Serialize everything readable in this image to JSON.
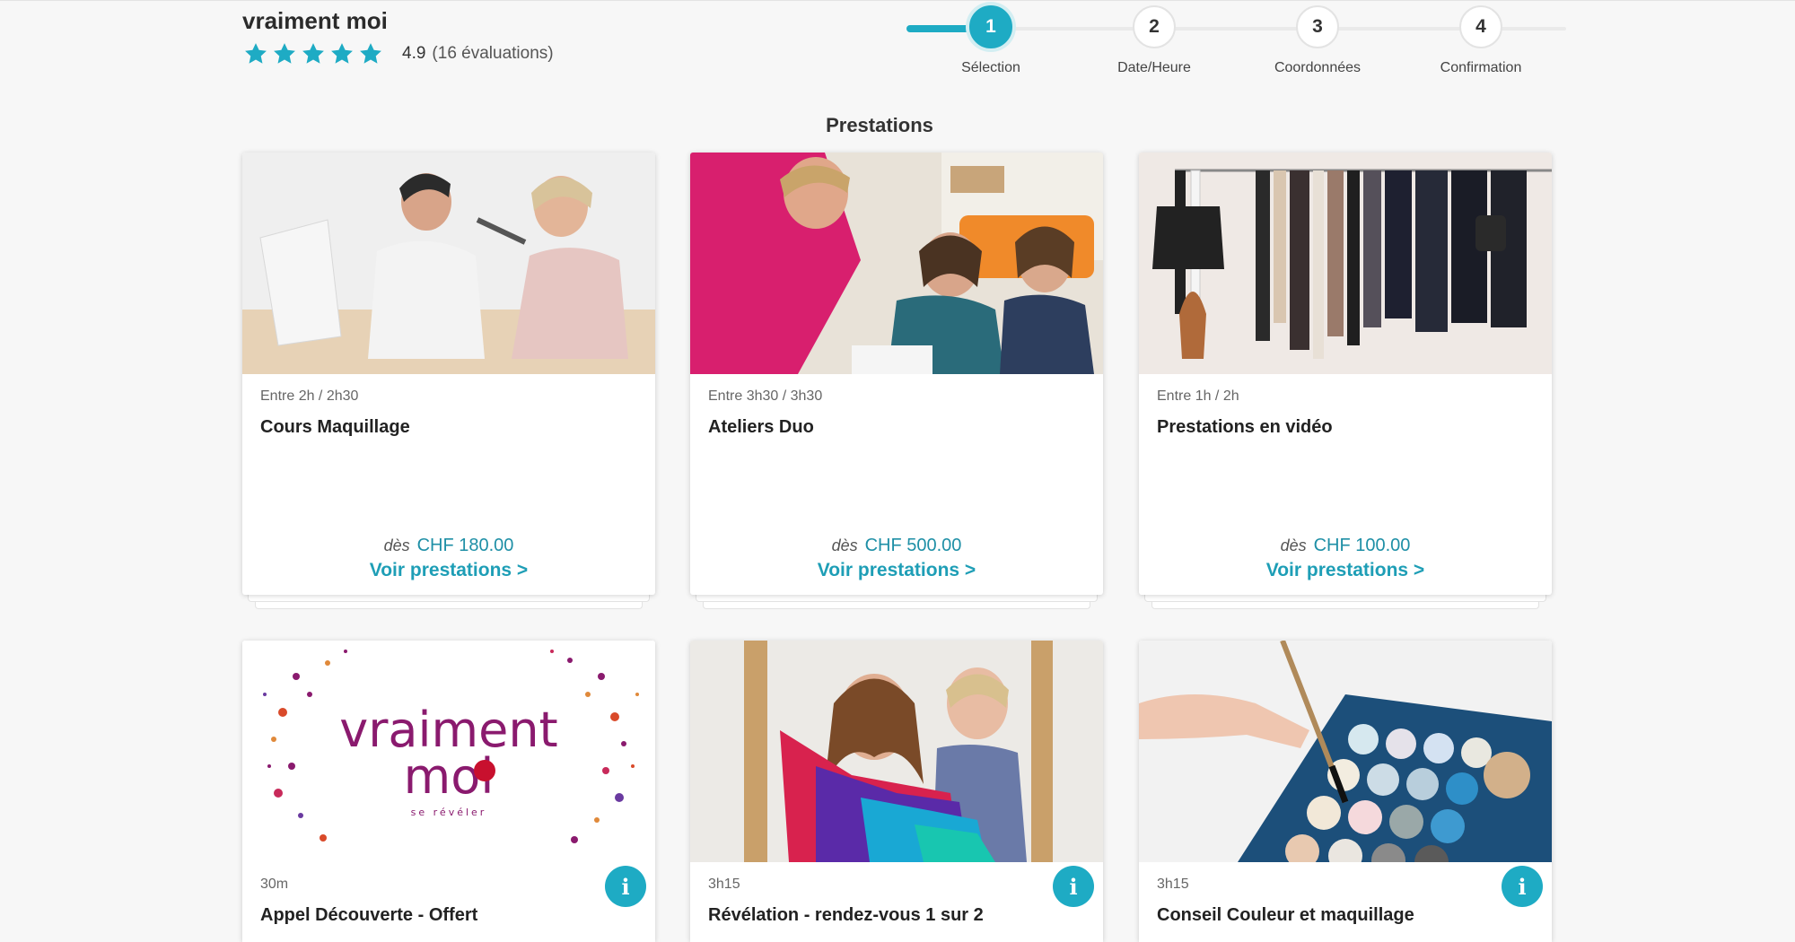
{
  "business": {
    "name": "vraiment moi",
    "rating_value": "4.9",
    "rating_count": "(16 évaluations)",
    "stars": 5
  },
  "stepper": {
    "current_step": 1,
    "steps": [
      {
        "number": "1",
        "label": "Sélection"
      },
      {
        "number": "2",
        "label": "Date/Heure"
      },
      {
        "number": "3",
        "label": "Coordonnées"
      },
      {
        "number": "4",
        "label": "Confirmation"
      }
    ]
  },
  "section_title": "Prestations",
  "cards": [
    {
      "duration": "Entre 2h / 2h30",
      "title": "Cours Maquillage",
      "price_prefix": "dès",
      "price": "CHF 180.00",
      "link": "Voir prestations  >"
    },
    {
      "duration": "Entre 3h30 / 3h30",
      "title": "Ateliers Duo",
      "price_prefix": "dès",
      "price": "CHF 500.00",
      "link": "Voir prestations  >"
    },
    {
      "duration": "Entre 1h / 2h",
      "title": "Prestations en vidéo",
      "price_prefix": "dès",
      "price": "CHF 100.00",
      "link": "Voir prestations  >"
    },
    {
      "duration": "30m",
      "title": "Appel Découverte - Offert",
      "info_icon": "i"
    },
    {
      "duration": "3h15",
      "title": "Révélation - rendez-vous 1 sur 2",
      "info_icon": "i"
    },
    {
      "duration": "3h15",
      "title": "Conseil Couleur et maquillage",
      "info_icon": "i"
    }
  ],
  "logo": {
    "line1": "vraiment",
    "line2": "moi",
    "tagline": "se révéler"
  },
  "colors": {
    "accent": "#1eabc4",
    "link": "#1e9eb6",
    "star": "#1eabc4",
    "logo": "#8a1a6e"
  }
}
